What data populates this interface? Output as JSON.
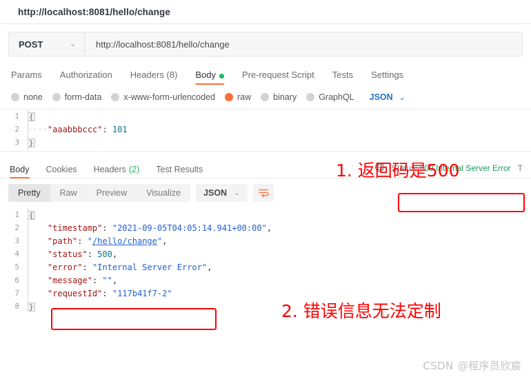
{
  "tab": {
    "title": "http://localhost:8081/hello/change"
  },
  "request": {
    "method": "POST",
    "method_chevron": "⌄",
    "url": "http://localhost:8081/hello/change",
    "tabs": [
      {
        "label": "Params",
        "active": false
      },
      {
        "label": "Authorization",
        "active": false
      },
      {
        "label": "Headers (8)",
        "active": false
      },
      {
        "label": "Body",
        "active": true,
        "dot": true
      },
      {
        "label": "Pre-request Script",
        "active": false
      },
      {
        "label": "Tests",
        "active": false
      },
      {
        "label": "Settings",
        "active": false
      }
    ],
    "body_types": [
      {
        "label": "none",
        "selected": false
      },
      {
        "label": "form-data",
        "selected": false
      },
      {
        "label": "x-www-form-urlencoded",
        "selected": false
      },
      {
        "label": "raw",
        "selected": true
      },
      {
        "label": "binary",
        "selected": false
      },
      {
        "label": "GraphQL",
        "selected": false
      }
    ],
    "format": {
      "label": "JSON",
      "chevron": "⌄"
    },
    "code": {
      "lines": [
        "1",
        "2",
        "3"
      ],
      "l1_brace": "{",
      "l2_indent": "····",
      "l2_key": "\"aaabbbccc\"",
      "l2_colon": ": ",
      "l2_value": "101",
      "l3_brace": "}"
    }
  },
  "response": {
    "tabs": [
      {
        "label": "Body",
        "active": true,
        "count": ""
      },
      {
        "label": "Cookies",
        "active": false,
        "count": ""
      },
      {
        "label": "Headers",
        "active": false,
        "count": "(2)"
      },
      {
        "label": "Test Results",
        "active": false,
        "count": ""
      }
    ],
    "status_prefix": "Status: ",
    "status_value": "500 Internal Server Error",
    "time_truncated": "T",
    "viewer": {
      "modes": [
        {
          "label": "Pretty",
          "active": true
        },
        {
          "label": "Raw",
          "active": false
        },
        {
          "label": "Preview",
          "active": false
        },
        {
          "label": "Visualize",
          "active": false
        }
      ],
      "format": {
        "label": "JSON",
        "chevron": "⌄"
      }
    },
    "code": {
      "lines": [
        "1",
        "2",
        "3",
        "4",
        "5",
        "6",
        "7",
        "8"
      ],
      "l1": "{",
      "l2_key": "\"timestamp\"",
      "l2_val": "\"2021-09-05T04:05:14.941+00:00\"",
      "l3_key": "\"path\"",
      "l3_val": "\"/hello/change\"",
      "l3_link": "/hello/change",
      "l4_key": "\"status\"",
      "l4_val": "500",
      "l5_key": "\"error\"",
      "l5_val": "\"Internal Server Error\"",
      "l6_key": "\"message\"",
      "l6_val": "\"\"",
      "l7_key": "\"requestId\"",
      "l7_val": "\"117b41f7-2\"",
      "l8": "}"
    }
  },
  "annotations": {
    "note1": "1. 返回码是500",
    "note2": "2. 错误信息无法定制"
  },
  "watermark": {
    "brand": "CSDN",
    "author": "@程序员欣宸"
  }
}
